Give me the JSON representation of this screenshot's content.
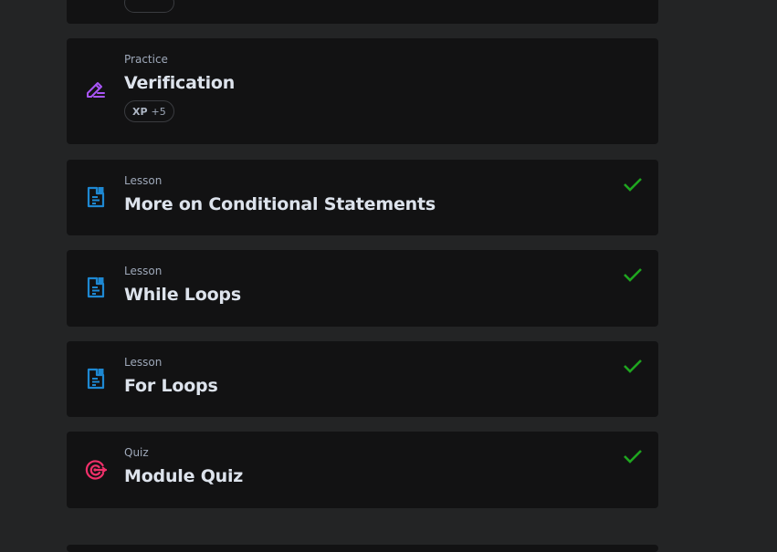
{
  "items": [
    {
      "kind": "Practice",
      "title": "Verification",
      "icon": "pencil-icon",
      "xp_label": "XP",
      "xp_value": "+5",
      "completed": false
    },
    {
      "kind": "Lesson",
      "title": "More on Conditional Statements",
      "icon": "lesson-document-icon",
      "completed": true
    },
    {
      "kind": "Lesson",
      "title": "While Loops",
      "icon": "lesson-document-icon",
      "completed": true
    },
    {
      "kind": "Lesson",
      "title": "For Loops",
      "icon": "lesson-document-icon",
      "completed": true
    },
    {
      "kind": "Quiz",
      "title": "Module Quiz",
      "icon": "target-icon",
      "completed": true
    }
  ],
  "colors": {
    "background": "#232425",
    "card": "#121213",
    "practice_icon": "#a855f7",
    "lesson_icon": "#1e88d2",
    "quiz_icon": "#f0306a",
    "check": "#1fa51f"
  }
}
